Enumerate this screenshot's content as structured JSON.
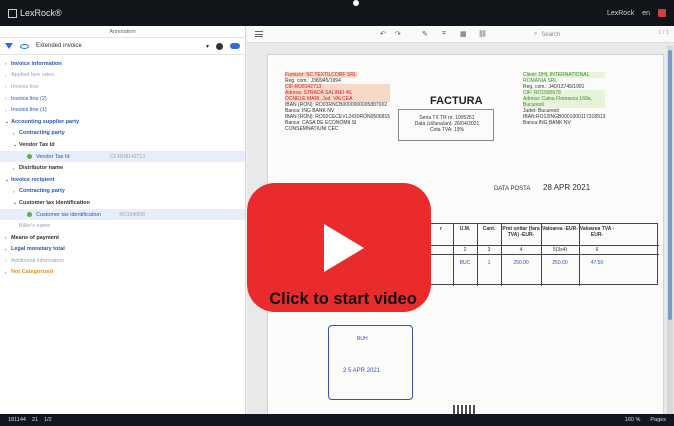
{
  "app": {
    "name": "LexRock®",
    "user": "LexRock",
    "language": "en"
  },
  "left_panel": {
    "title": "Annotation",
    "document_type": "Extended invoice",
    "tree": [
      {
        "label": "Invoice information",
        "style": "blue bold",
        "arrow": "›"
      },
      {
        "label": "Applied fare rates",
        "style": "muted",
        "arrow": "›"
      },
      {
        "label": "Invoice line",
        "style": "muted",
        "arrow": "›"
      },
      {
        "label": "Invoice line (2)",
        "style": "blue",
        "arrow": "›"
      },
      {
        "label": "Invoice line (1)",
        "style": "blue",
        "arrow": "›"
      },
      {
        "label": "Accounting supplier party",
        "style": "blue bold",
        "arrow": "⌄"
      },
      {
        "label": "Contracting party",
        "style": "blue bold",
        "arrow": "›",
        "indent": 8
      },
      {
        "label": "Vendor Tax Id",
        "style": "bold",
        "arrow": "⌄",
        "indent": 8
      },
      {
        "label": "Vendor Tax Id",
        "style": "blue",
        "leaf": true,
        "value": "CF:RO8142713",
        "indent": 16,
        "selected": true
      },
      {
        "label": "Distributor name",
        "style": "bold",
        "arrow": "›",
        "indent": 8
      },
      {
        "label": "Invoice recipient",
        "style": "blue bold",
        "arrow": "⌄"
      },
      {
        "label": "Contracting party",
        "style": "blue bold",
        "arrow": "›",
        "indent": 8
      },
      {
        "label": "Customer tax identification",
        "style": "bold",
        "arrow": "⌄",
        "indent": 8
      },
      {
        "label": "Customer tax identification",
        "style": "blue",
        "leaf": true,
        "value": "RO15906/8",
        "indent": 16,
        "selected": true
      },
      {
        "label": "Biller's name",
        "style": "muted",
        "arrow": "",
        "indent": 8
      },
      {
        "label": "Means of payment",
        "style": "bold",
        "arrow": "›"
      },
      {
        "label": "Legal monetary total",
        "style": "blue bold",
        "arrow": "›"
      },
      {
        "label": "Additional information",
        "style": "muted",
        "arrow": "›"
      },
      {
        "label": "Not Categorized",
        "style": "orange bold",
        "arrow": "›"
      }
    ]
  },
  "viewer": {
    "search_placeholder": "Search",
    "page_count": "1 / 1",
    "supplier": "Furnizor: SC TEXTILCORF SRL",
    "reg_com": "Reg. com.: J38/945/1994",
    "cif": "CIF:RO8142713",
    "address": "Adresa: STRADA SALINEI 46,",
    "city": "OCNELE MARI, Jud. VALCEA",
    "iban1": "IBAN (RON): RO03RNCB0000000005887002",
    "bank1": "Banca: ING BANK NV",
    "iban2": "IBAN (RON): RO02CECEVL2430RON0506815",
    "bank2": "Banca: CASA DE ECONOMII SI",
    "bank2b": "CONSEMNATIUNI CEC",
    "title": "FACTURA",
    "series": "Seria TX TR nr. 1005251",
    "date": "Data (zi/luna/an): 26/04/2021",
    "vat": "Cota TVA: 19%",
    "client": "Client: DHL INTERNATIONAL",
    "client2": "ROMANIA SRL",
    "client_reg": "Reg. com.: J40/13745/1991",
    "client_cif": "CIF: RO1590678",
    "client_address": "Adresa: Calea Floreasca 169a,",
    "client_city": "Bucuresti",
    "client_county": "Judet: Bucuresti",
    "client_iban": "IBAN:RO12INGB0001000117318913",
    "client_bank": "Banca:ING BANK NV",
    "data_posta": "DATA POSTA",
    "data_posta_value": "28 APR 2021",
    "table_headers": [
      "r",
      "U.M.",
      "Cant.",
      "Pret unitar (fara TVA) -EUR-",
      "Valoarea -EUR-",
      "Valoarea TVA -EUR-"
    ],
    "table_index": [
      "",
      "2",
      "3",
      "4",
      "5(3x4)",
      "6"
    ],
    "table_row": [
      "",
      "BUC",
      "1",
      "250.00",
      "250.00",
      "47.50"
    ],
    "stamp_label": "BUH",
    "stamp_date": "2 5 APR 2021"
  },
  "overlay": {
    "caption": "Click to start video"
  },
  "status": {
    "left": "181144",
    "pages": "21",
    "fraction": "1/2",
    "zoom": "160 %",
    "right": "Pages"
  }
}
